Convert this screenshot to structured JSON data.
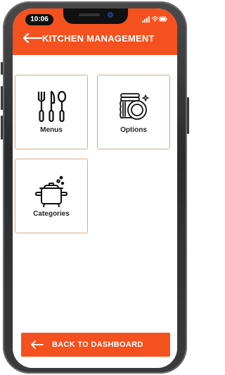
{
  "status_bar": {
    "time": "10:06"
  },
  "header": {
    "title": "KITCHEN MANAGEMENT",
    "back_icon": "arrow-left-icon"
  },
  "tiles": [
    {
      "label": "Menus",
      "icon": "cutlery-icon"
    },
    {
      "label": "Options",
      "icon": "plates-icon"
    },
    {
      "label": "Categories",
      "icon": "cooking-pot-icon"
    }
  ],
  "footer": {
    "button_label": "BACK TO DASHBOARD",
    "button_icon": "arrow-left-icon"
  },
  "colors": {
    "accent": "#f4511e",
    "tile_border": "#d2a88e"
  }
}
